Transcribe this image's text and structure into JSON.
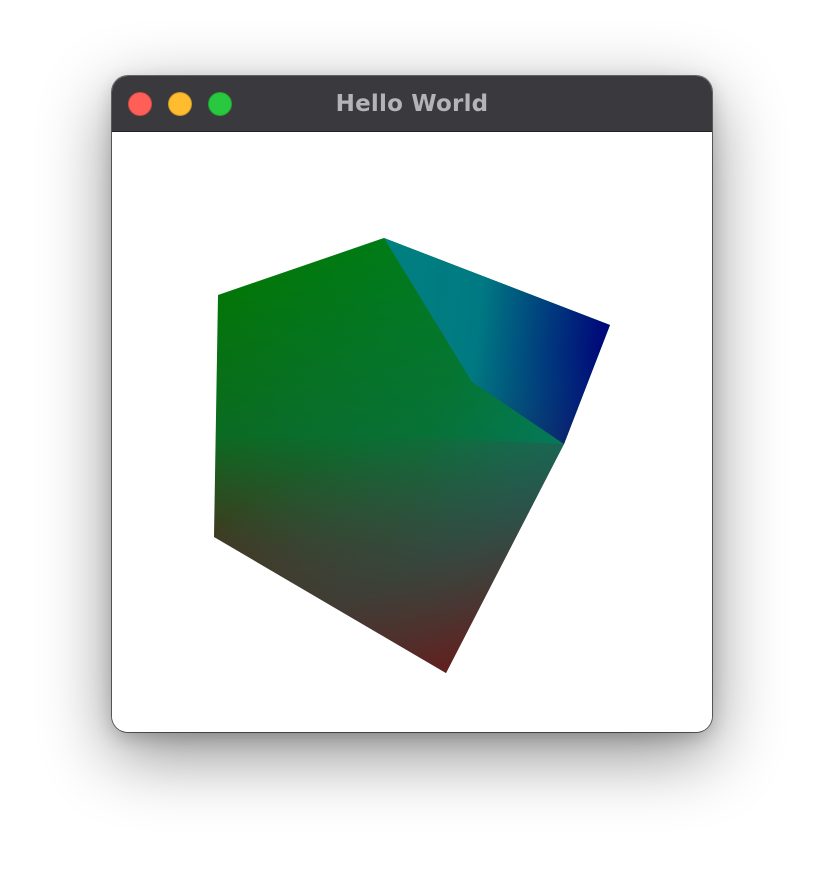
{
  "window": {
    "title": "Hello World",
    "controls": {
      "close": {
        "icon": "close-icon",
        "color": "#ff5f57"
      },
      "minimize": {
        "icon": "minimize-icon",
        "color": "#febc2e"
      },
      "zoom": {
        "icon": "zoom-icon",
        "color": "#28c840"
      }
    },
    "titlebar_color": "#3a393e",
    "title_color": "#b4b3b8"
  },
  "scene": {
    "object": "rgb-color-cube",
    "background": "#ffffff",
    "corner_colors": {
      "green": "#008000",
      "red": "#800000",
      "blue": "#000080",
      "teal": "#008080"
    }
  }
}
